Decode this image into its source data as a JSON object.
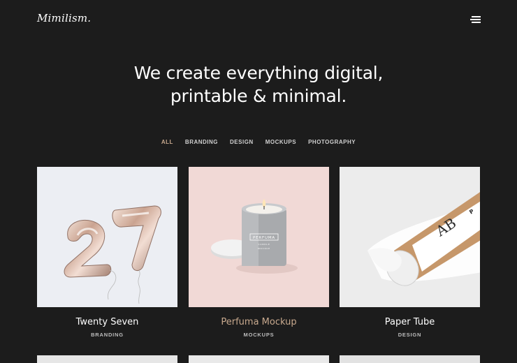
{
  "header": {
    "logo": "Mimilism."
  },
  "hero": {
    "line1": "We create everything digital,",
    "line2": "printable & minimal."
  },
  "filters": [
    "ALL",
    "BRANDING",
    "DESIGN",
    "MOCKUPS",
    "PHOTOGRAPHY"
  ],
  "projects": [
    {
      "title": "Twenty Seven",
      "category": "BRANDING",
      "image_text": "27"
    },
    {
      "title": "Perfuma Mockup",
      "category": "MOCKUPS",
      "image_text": "PERFUMA"
    },
    {
      "title": "Paper Tube",
      "category": "DESIGN",
      "image_text": "AB"
    }
  ],
  "colors": {
    "background": "#1c1c1c",
    "accent": "#c8a98e",
    "text": "#ffffff"
  }
}
